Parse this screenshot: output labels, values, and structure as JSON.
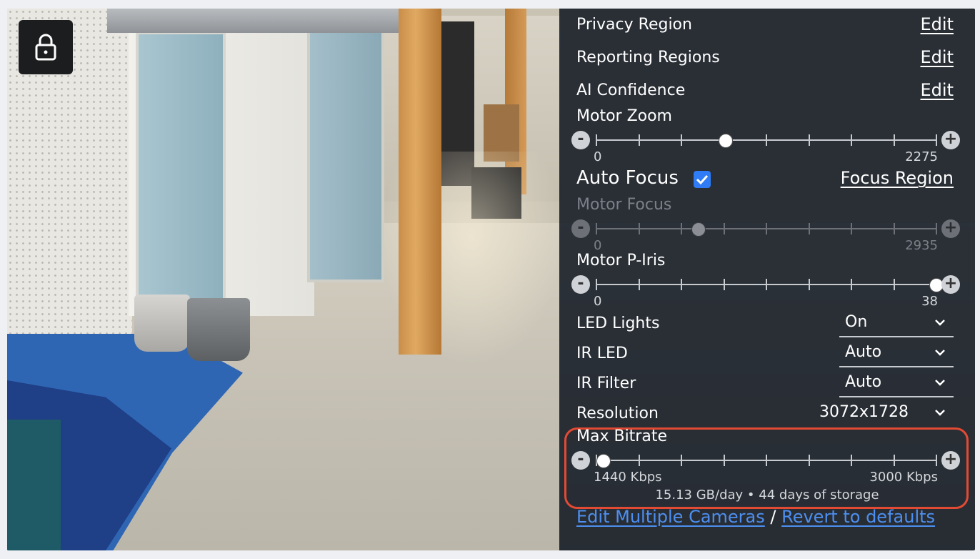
{
  "panel": {
    "privacy_region": {
      "label": "Privacy Region",
      "action": "Edit"
    },
    "reporting_regions": {
      "label": "Reporting Regions",
      "action": "Edit"
    },
    "ai_confidence": {
      "label": "AI Confidence",
      "action": "Edit"
    },
    "motor_zoom": {
      "label": "Motor Zoom",
      "min": "0",
      "max": "2275",
      "level": 0.38
    },
    "auto_focus": {
      "label": "Auto Focus",
      "checked": true,
      "link": "Focus Region"
    },
    "motor_focus": {
      "label": "Motor Focus",
      "min": "0",
      "max": "2935",
      "level": 0.3,
      "disabled": true
    },
    "motor_piris": {
      "label": "Motor P-Iris",
      "min": "0",
      "max": "38",
      "level": 1.0
    },
    "led_lights": {
      "label": "LED Lights",
      "value": "On"
    },
    "ir_led": {
      "label": "IR LED",
      "value": "Auto"
    },
    "ir_filter": {
      "label": "IR Filter",
      "value": "Auto"
    },
    "resolution": {
      "label": "Resolution",
      "value": "3072x1728"
    },
    "max_bitrate": {
      "label": "Max Bitrate",
      "min": "1440 Kbps",
      "max": "3000 Kbps",
      "level": 0.02,
      "storage": "15.13 GB/day • 44 days of storage"
    },
    "slider_buttons": {
      "minus": "-",
      "plus": "+"
    }
  },
  "footer": {
    "edit_multiple": "Edit Multiple Cameras",
    "separator": " / ",
    "revert": "Revert to defaults"
  },
  "icons": {
    "lock": "lock-icon",
    "more": "more-options-icon",
    "chevron": "chevron-down-icon",
    "check": "checkmark-icon"
  },
  "colors": {
    "panel_bg": "#0f1621",
    "link": "#4d8ff0",
    "highlight": "#e34a33",
    "checkbox": "#2f7cf6"
  }
}
